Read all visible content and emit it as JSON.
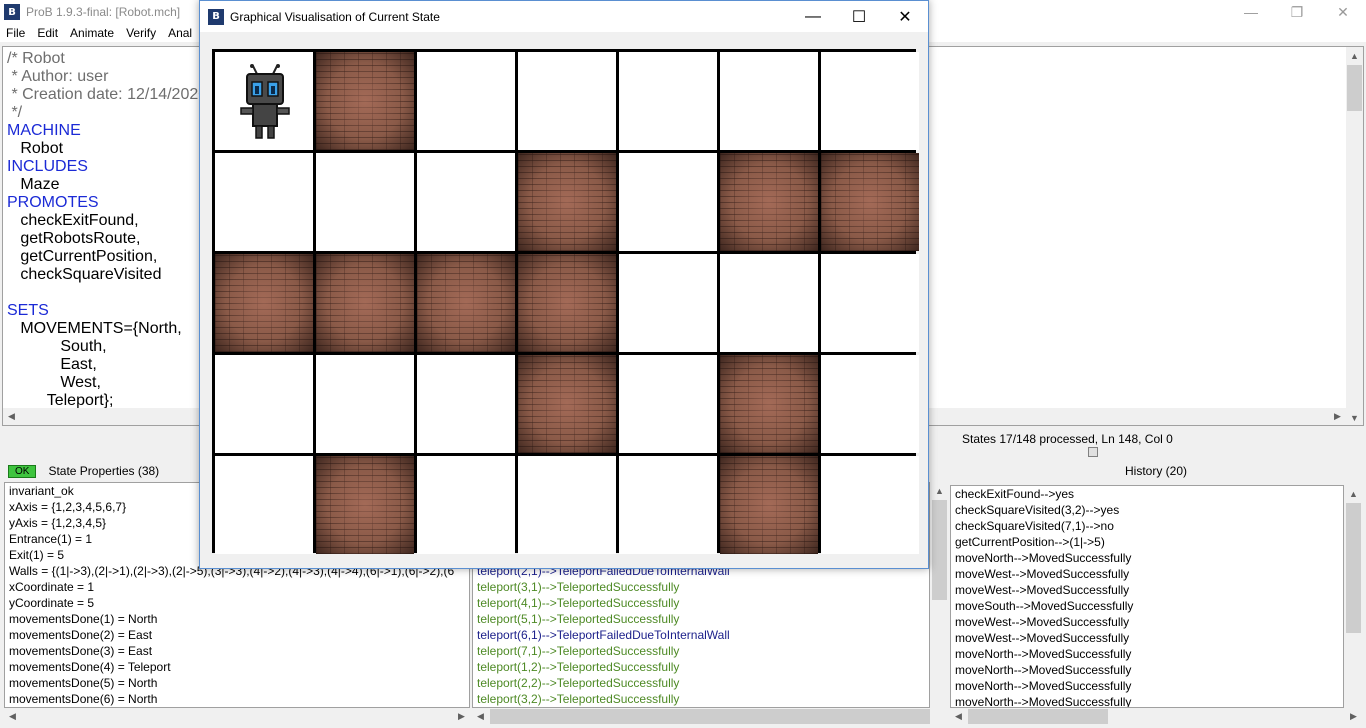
{
  "main_window": {
    "title": "ProB 1.9.3-final: [Robot.mch]",
    "logo_text": "B",
    "controls": [
      "minimize",
      "restore",
      "close"
    ]
  },
  "menu": [
    "File",
    "Edit",
    "Animate",
    "Verify",
    "Anal"
  ],
  "editor": {
    "lines": [
      {
        "text": "/* Robot",
        "kind": "comment"
      },
      {
        "text": " * Author: user",
        "kind": "comment"
      },
      {
        "text": " * Creation date: 12/14/2020",
        "kind": "comment"
      },
      {
        "text": " */",
        "kind": "comment"
      },
      {
        "text": "MACHINE",
        "kind": "kw"
      },
      {
        "text": "   Robot",
        "kind": "plain"
      },
      {
        "text": "INCLUDES",
        "kind": "kw"
      },
      {
        "text": "   Maze",
        "kind": "plain"
      },
      {
        "text": "PROMOTES",
        "kind": "kw"
      },
      {
        "text": "   checkExitFound,",
        "kind": "plain"
      },
      {
        "text": "   getRobotsRoute,",
        "kind": "plain"
      },
      {
        "text": "   getCurrentPosition,",
        "kind": "plain"
      },
      {
        "text": "   checkSquareVisited",
        "kind": "plain"
      },
      {
        "text": "",
        "kind": "plain"
      },
      {
        "text": "SETS",
        "kind": "kw"
      },
      {
        "text": "   MOVEMENTS={North,",
        "kind": "plain"
      },
      {
        "text": "            South,",
        "kind": "plain"
      },
      {
        "text": "            East,",
        "kind": "plain"
      },
      {
        "text": "            West,",
        "kind": "plain"
      },
      {
        "text": "         Teleport};",
        "kind": "plain"
      }
    ]
  },
  "status": {
    "text": "States 17/148 processed, Ln 148, Col 0"
  },
  "state_properties": {
    "badge": "OK",
    "header": "State Properties (38)",
    "items": [
      "invariant_ok",
      "xAxis = {1,2,3,4,5,6,7}",
      "yAxis = {1,2,3,4,5}",
      "Entrance(1) = 1",
      "Exit(1) = 5",
      "Walls = {(1|->3),(2|->1),(2|->3),(2|->5),(3|->3),(4|->2),(4|->3),(4|->4),(6|->1),(6|->2),(6",
      "xCoordinate = 1",
      "yCoordinate = 5",
      "movementsDone(1) = North",
      "movementsDone(2) = East",
      "movementsDone(3) = East",
      "movementsDone(4) = Teleport",
      "movementsDone(5) = North",
      "movementsDone(6) = North"
    ]
  },
  "enabled_operations": {
    "items": [
      {
        "text": "teleport(2,1)-->TeleportFailedDueToInternalWall",
        "status": "fail"
      },
      {
        "text": "teleport(3,1)-->TeleportedSuccessfully",
        "status": "ok"
      },
      {
        "text": "teleport(4,1)-->TeleportedSuccessfully",
        "status": "ok"
      },
      {
        "text": "teleport(5,1)-->TeleportedSuccessfully",
        "status": "ok"
      },
      {
        "text": "teleport(6,1)-->TeleportFailedDueToInternalWall",
        "status": "fail"
      },
      {
        "text": "teleport(7,1)-->TeleportedSuccessfully",
        "status": "ok"
      },
      {
        "text": "teleport(1,2)-->TeleportedSuccessfully",
        "status": "ok"
      },
      {
        "text": "teleport(2,2)-->TeleportedSuccessfully",
        "status": "ok"
      },
      {
        "text": "teleport(3,2)-->TeleportedSuccessfully",
        "status": "ok"
      }
    ]
  },
  "history": {
    "header": "History (20)",
    "items": [
      "checkExitFound-->yes",
      "checkSquareVisited(3,2)-->yes",
      "checkSquareVisited(7,1)-->no",
      "getCurrentPosition-->(1|->5)",
      "moveNorth-->MovedSuccessfully",
      "moveWest-->MovedSuccessfully",
      "moveWest-->MovedSuccessfully",
      "moveSouth-->MovedSuccessfully",
      "moveWest-->MovedSuccessfully",
      "moveWest-->MovedSuccessfully",
      "moveNorth-->MovedSuccessfully",
      "moveNorth-->MovedSuccessfully",
      "moveNorth-->MovedSuccessfully",
      "moveNorth-->MovedSuccessfully"
    ]
  },
  "visualisation": {
    "title": "Graphical Visualisation of Current State",
    "logo_text": "B",
    "controls": [
      "minimize",
      "maximize",
      "close"
    ],
    "grid": [
      [
        "robot",
        "wall",
        "empty",
        "empty",
        "empty",
        "empty",
        "empty"
      ],
      [
        "empty",
        "empty",
        "empty",
        "wall",
        "empty",
        "wall",
        "wall"
      ],
      [
        "wall",
        "wall",
        "wall",
        "wall",
        "empty",
        "empty",
        "empty"
      ],
      [
        "empty",
        "empty",
        "empty",
        "wall",
        "empty",
        "wall",
        "empty"
      ],
      [
        "empty",
        "wall",
        "empty",
        "empty",
        "empty",
        "wall",
        "empty"
      ]
    ]
  }
}
